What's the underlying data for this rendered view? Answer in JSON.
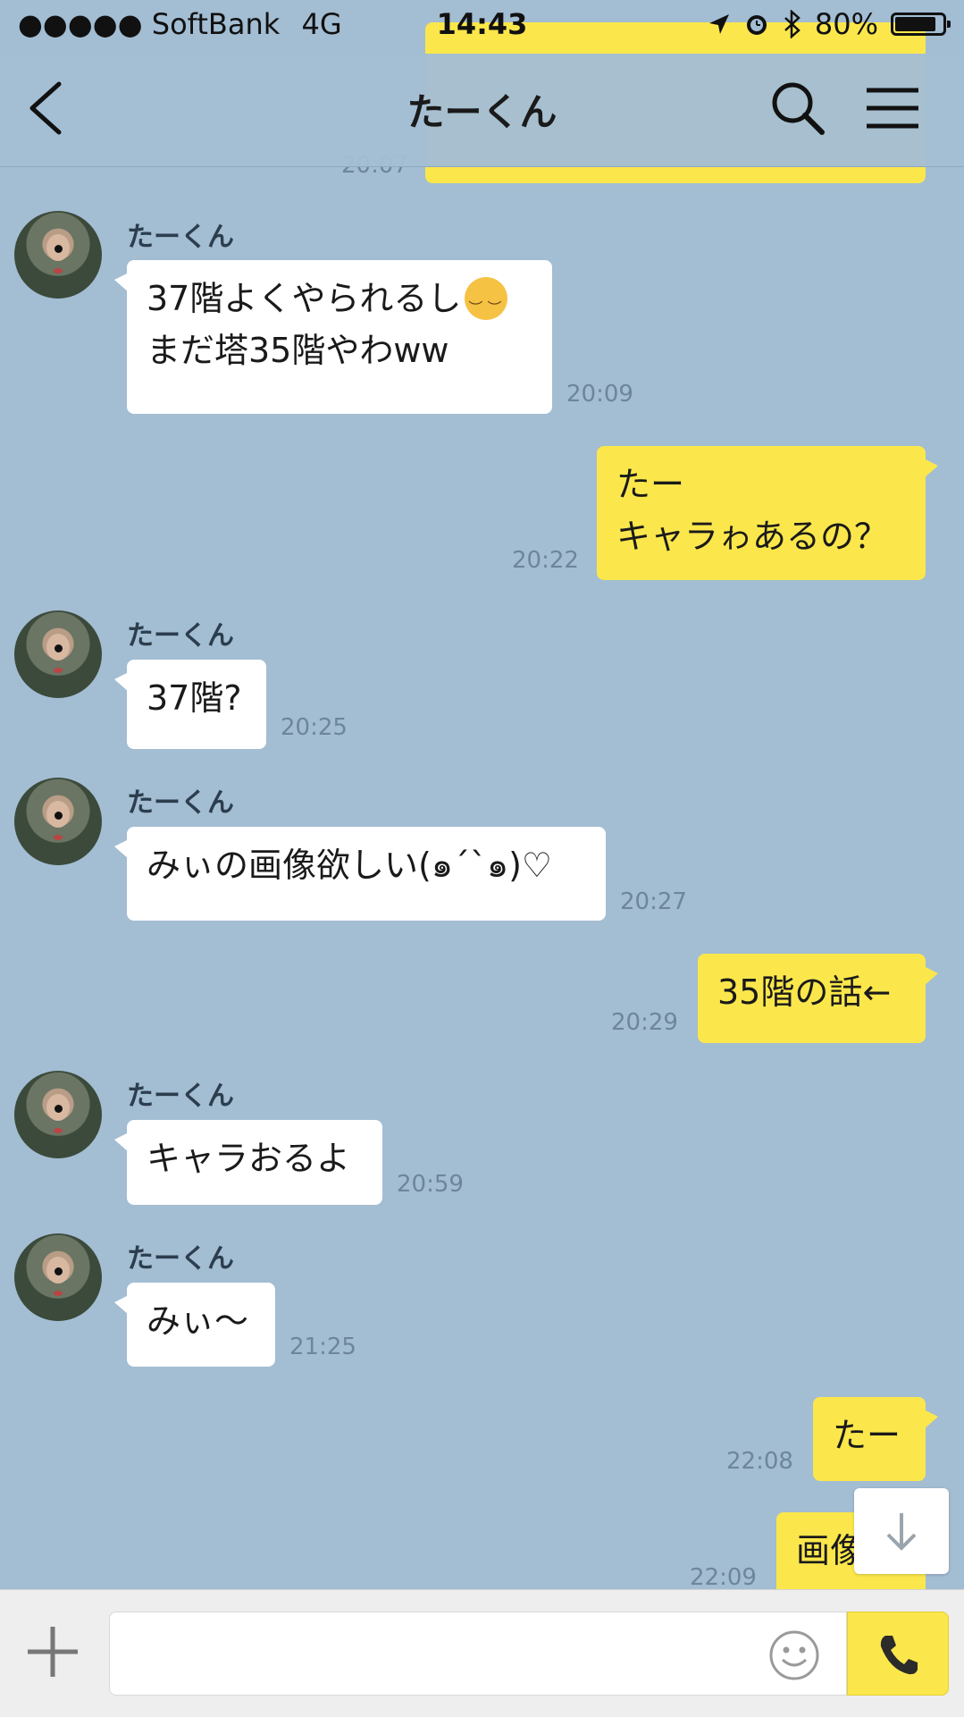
{
  "status_bar": {
    "carrier": "●●●●● SoftBank",
    "network": "4G",
    "time": "14:43",
    "battery": "80%",
    "battery_level": 0.8
  },
  "header": {
    "title": "たーくん"
  },
  "previous_message_time": "20:07",
  "contact_name": "たーくん",
  "messages": [
    {
      "side": "left",
      "lines": [
        "37階よくやられるし",
        "まだ塔35階やわww"
      ],
      "emoji": "pensive-face-emoji",
      "time": "20:09"
    },
    {
      "side": "right",
      "lines": [
        "たー",
        "キャラゎあるの？"
      ],
      "time": "20:22"
    },
    {
      "side": "left",
      "lines": [
        "37階?"
      ],
      "time": "20:25"
    },
    {
      "side": "left",
      "lines": [
        "みぃの画像欲しい(๑´`๑)♡"
      ],
      "time": "20:27"
    },
    {
      "side": "right",
      "lines": [
        "35階の話←"
      ],
      "time": "20:29"
    },
    {
      "side": "left",
      "lines": [
        "キャラおるよ"
      ],
      "time": "20:59"
    },
    {
      "side": "left",
      "lines": [
        "みぃ〜"
      ],
      "time": "21:25"
    },
    {
      "side": "right",
      "lines": [
        "たー"
      ],
      "time": "22:08"
    },
    {
      "side": "right",
      "lines": [
        "画像"
      ],
      "time": "22:09"
    }
  ],
  "colors": {
    "background": "#a3bdd3",
    "outgoing_bubble": "#fbe74b",
    "incoming_bubble": "#ffffff"
  },
  "icons": {
    "back": "chevron-left-icon",
    "search": "search-icon",
    "menu": "hamburger-menu-icon",
    "add": "plus-icon",
    "sticker": "smiley-icon",
    "call": "phone-icon",
    "scroll": "arrow-down-icon"
  }
}
